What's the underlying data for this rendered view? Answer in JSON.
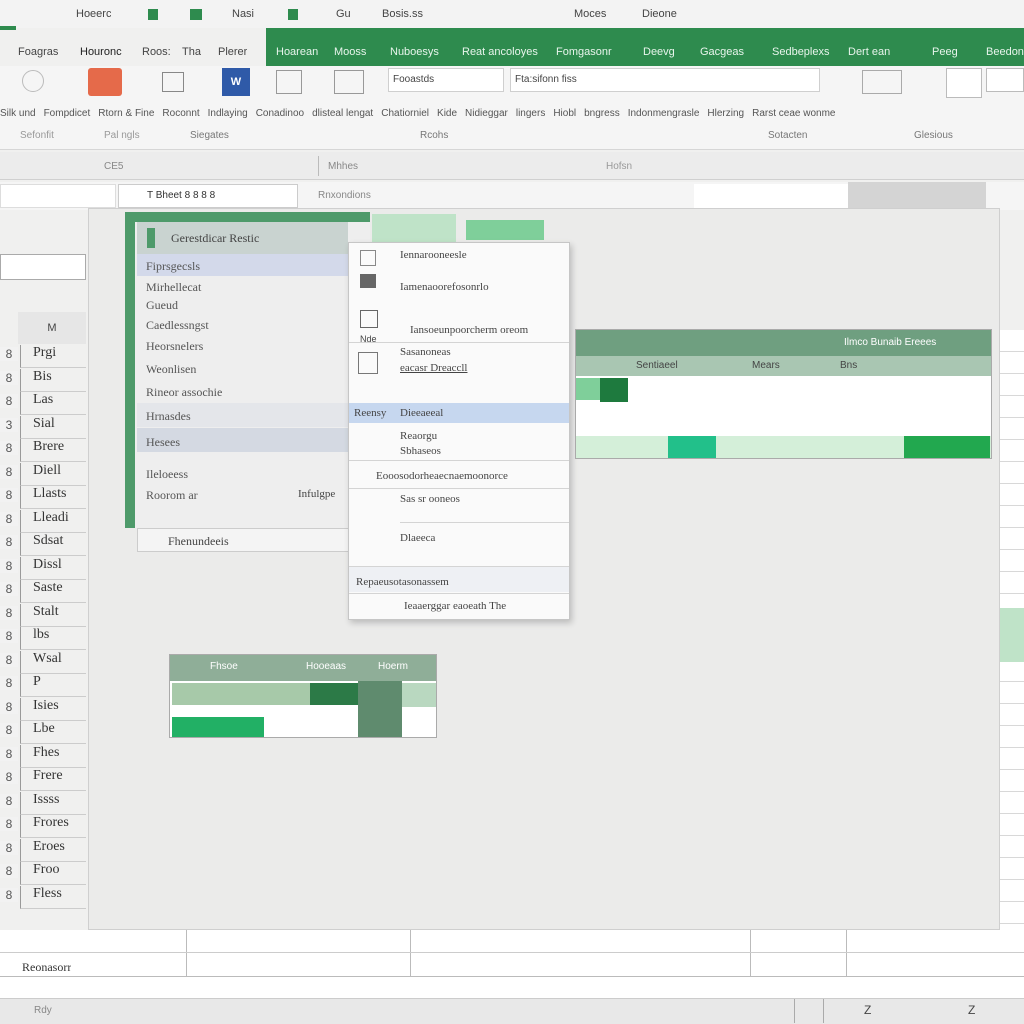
{
  "colors": {
    "accent": "#2e8b4e",
    "accent_dark": "#1e7a3e",
    "light_green": "#bfe3c8",
    "bright_green": "#22b065",
    "selection": "#c6d7ef"
  },
  "titlebar": {
    "items": [
      "Hoeerc",
      "Nasi",
      "Gu",
      "Bosis.ss",
      "Moces",
      "Dieone"
    ]
  },
  "left_tabs": [
    "Foagras",
    "Houronc",
    "Roos:",
    "Tha",
    "Plerer"
  ],
  "ribbon_tabs": [
    "Hoarean",
    "Mooss",
    "Nuboesys",
    "Reat ancoloyes",
    "Fomgasonr",
    "Deevg",
    "Gacgeas",
    "Sedbeplexs",
    "Dert ean",
    "Peeg",
    "Beedonos"
  ],
  "ribbon": {
    "input1": "Fooastds",
    "input2": "Fta:sifonn fiss",
    "labels": [
      "Silk und",
      "Fompdicet",
      "Rtorn & Fine",
      "Roconnt",
      "Indlaying",
      "Conadinoo",
      "dlisteal lengat",
      "Chatiorniel",
      "Kide",
      "Nidieggar",
      "lingers",
      "Hiobl",
      "bngress",
      "Indonmengrasle",
      "Hlerzing",
      "Rarst ceae wonme"
    ],
    "groups": [
      "Sefonfit",
      "Pal ngls",
      "Siegates",
      "Rcohs",
      "Sotacten",
      "Glesious"
    ]
  },
  "formula_bar": {
    "name_box": "CE5",
    "hint": "Mhhes",
    "center": "Hofsn"
  },
  "name_bar": {
    "sheet_label": "T Bheet 8 8 8 8",
    "cell_ref": "Rnxondions"
  },
  "left_sheet": {
    "header": "M",
    "rows": [
      {
        "n": "8",
        "t": "Prgi"
      },
      {
        "n": "8",
        "t": "Bis"
      },
      {
        "n": "8",
        "t": "Las"
      },
      {
        "n": "3",
        "t": "Sial"
      },
      {
        "n": "8",
        "t": "Brere"
      },
      {
        "n": "8",
        "t": "Diell"
      },
      {
        "n": "8",
        "t": "Llasts"
      },
      {
        "n": "8",
        "t": "Lleadi"
      },
      {
        "n": "8",
        "t": "Sdsat"
      },
      {
        "n": "8",
        "t": "Dissl"
      },
      {
        "n": "8",
        "t": "Saste"
      },
      {
        "n": "8",
        "t": "Stalt"
      },
      {
        "n": "8",
        "t": "lbs"
      },
      {
        "n": "8",
        "t": "Wsal"
      },
      {
        "n": "8",
        "t": "P"
      },
      {
        "n": "8",
        "t": "Isies"
      },
      {
        "n": "8",
        "t": "Lbe"
      },
      {
        "n": "8",
        "t": "Fhes"
      },
      {
        "n": "8",
        "t": "Frere"
      },
      {
        "n": "8",
        "t": "Issss"
      },
      {
        "n": "8",
        "t": "Frores"
      },
      {
        "n": "8",
        "t": "Eroes"
      },
      {
        "n": "8",
        "t": "Froo"
      },
      {
        "n": "8",
        "t": "Fless"
      }
    ]
  },
  "panel": {
    "title": "Gerestdicar Restic",
    "items": [
      "Fiprsgecsls",
      "Mirhellecat",
      "Gueud",
      "Caedlessngst",
      "Heorsnelers",
      "Weonlisen",
      "Rineor assochie",
      "Hrnasdes",
      "Hesees",
      "Ileloeess",
      "Roorom ar"
    ],
    "side_value": "Infulgpe",
    "footer": "Fhenundeeis"
  },
  "context_menu": {
    "items": [
      "Iennarooneesle",
      "Iamenaoorefosonrlo",
      "Iansoeunpoorcherm oreom",
      "Sasanoneas",
      "eacasr Dreaccll",
      "Dieeaeeal",
      "Reaorgu",
      "Sbhaseos",
      "Eooosodorheaecnaemoonorce",
      "Sas sr ooneos",
      "Dlaeeca",
      "Repaeusotasonassem",
      "Ieaaerggar eaoeath The"
    ],
    "selected_left": "Reensy",
    "icon_caption": "Nde"
  },
  "table1": {
    "header": [
      "Ilmco Bunaib Ereees"
    ],
    "cols": [
      "Sentiaeel",
      "Mears",
      "Bns"
    ]
  },
  "table2": {
    "cols": [
      "Fhsoe",
      "Hooeaas",
      "Hoerm"
    ]
  },
  "bottom": {
    "tab": "Reonasorr"
  },
  "status": {
    "left": "Rdy",
    "right": [
      "Z",
      "Z"
    ]
  }
}
